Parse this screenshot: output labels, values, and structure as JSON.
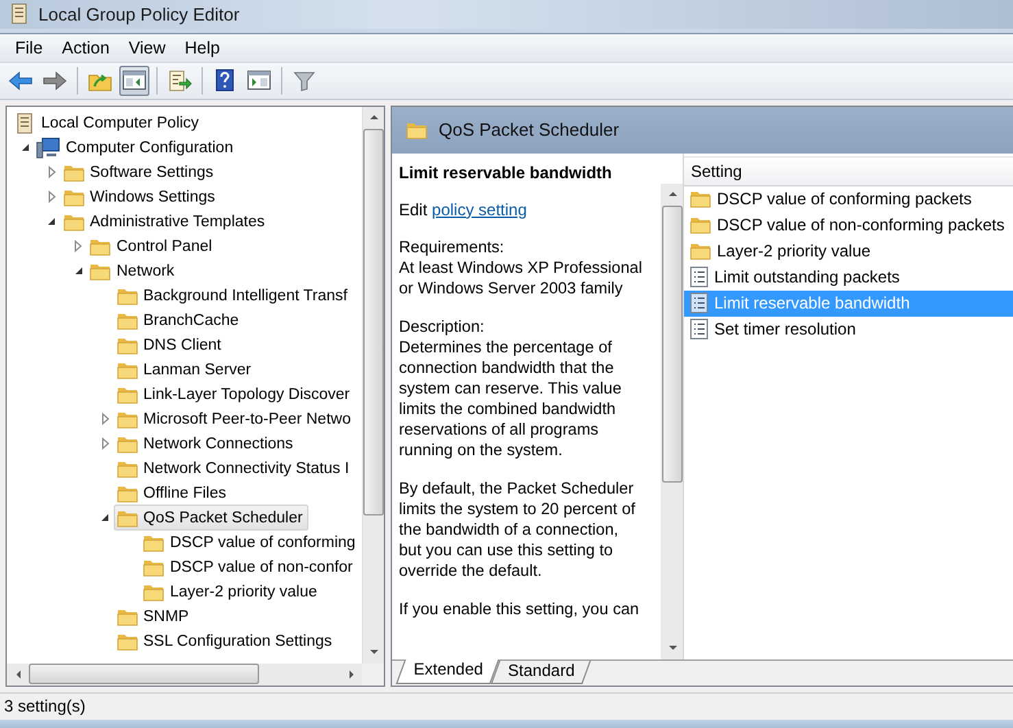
{
  "window": {
    "title": "Local Group Policy Editor"
  },
  "menu": [
    "File",
    "Action",
    "View",
    "Help"
  ],
  "toolbar": [
    {
      "kind": "back",
      "pressed": false
    },
    {
      "kind": "forward",
      "pressed": false
    },
    {
      "kind": "separator"
    },
    {
      "kind": "up",
      "pressed": false
    },
    {
      "kind": "console-tree",
      "pressed": true
    },
    {
      "kind": "separator"
    },
    {
      "kind": "export",
      "pressed": false
    },
    {
      "kind": "separator"
    },
    {
      "kind": "help",
      "pressed": false
    },
    {
      "kind": "action-pane",
      "pressed": false
    },
    {
      "kind": "separator"
    },
    {
      "kind": "filter",
      "pressed": false
    }
  ],
  "tree": [
    {
      "label": "Local Computer Policy",
      "kind": "policy",
      "selected": false,
      "children": [
        {
          "label": "Computer Configuration",
          "kind": "computer",
          "expanded": true,
          "selected": false,
          "children": [
            {
              "label": "Software Settings",
              "kind": "folder",
              "expanded": false,
              "selected": false
            },
            {
              "label": "Windows Settings",
              "kind": "folder",
              "expanded": false,
              "selected": false
            },
            {
              "label": "Administrative Templates",
              "kind": "folder",
              "expanded": true,
              "selected": false,
              "children": [
                {
                  "label": "Control Panel",
                  "kind": "folder",
                  "expanded": false,
                  "selected": false
                },
                {
                  "label": "Network",
                  "kind": "folder",
                  "expanded": true,
                  "selected": false,
                  "children": [
                    {
                      "label": "Background Intelligent Transf",
                      "kind": "folder",
                      "selected": false
                    },
                    {
                      "label": "BranchCache",
                      "kind": "folder",
                      "selected": false
                    },
                    {
                      "label": "DNS Client",
                      "kind": "folder",
                      "selected": false
                    },
                    {
                      "label": "Lanman Server",
                      "kind": "folder",
                      "selected": false
                    },
                    {
                      "label": "Link-Layer Topology Discover",
                      "kind": "folder",
                      "selected": false
                    },
                    {
                      "label": "Microsoft Peer-to-Peer Netwo",
                      "kind": "folder",
                      "expanded": false,
                      "selected": false
                    },
                    {
                      "label": "Network Connections",
                      "kind": "folder",
                      "expanded": false,
                      "selected": false
                    },
                    {
                      "label": "Network Connectivity Status I",
                      "kind": "folder",
                      "selected": false
                    },
                    {
                      "label": "Offline Files",
                      "kind": "folder",
                      "selected": false
                    },
                    {
                      "label": "QoS Packet Scheduler",
                      "kind": "folder",
                      "expanded": true,
                      "selected": true,
                      "children": [
                        {
                          "label": "DSCP value of conforming",
                          "kind": "folder",
                          "selected": false
                        },
                        {
                          "label": "DSCP value of non-confor",
                          "kind": "folder",
                          "selected": false
                        },
                        {
                          "label": "Layer-2 priority value",
                          "kind": "folder",
                          "selected": false
                        }
                      ]
                    },
                    {
                      "label": "SNMP",
                      "kind": "folder",
                      "selected": false
                    },
                    {
                      "label": "SSL Configuration Settings",
                      "kind": "folder",
                      "selected": false
                    }
                  ]
                }
              ]
            }
          ]
        }
      ]
    }
  ],
  "header": {
    "title": "QoS Packet Scheduler"
  },
  "description": {
    "title": "Limit reservable bandwidth",
    "edit_prefix": "Edit",
    "edit_link": "policy setting",
    "paragraphs": [
      [
        "Requirements:",
        "At least Windows XP Professional",
        "or Windows Server 2003 family"
      ],
      [
        "Description:",
        "Determines the percentage of",
        "connection bandwidth that the",
        "system can reserve. This value",
        "limits the combined bandwidth",
        "reservations of all programs",
        "running on the system."
      ],
      [
        "By default, the Packet Scheduler",
        "limits the system to 20 percent of",
        "the bandwidth of a connection,",
        "but you can use this setting to",
        "override the default."
      ],
      [
        "If you enable this setting, you can"
      ]
    ]
  },
  "list": {
    "column": "Setting",
    "rows": [
      {
        "label": "DSCP value of conforming packets",
        "kind": "folder",
        "selected": false
      },
      {
        "label": "DSCP value of non-conforming packets",
        "kind": "folder",
        "selected": false
      },
      {
        "label": "Layer-2 priority value",
        "kind": "folder",
        "selected": false
      },
      {
        "label": "Limit outstanding packets",
        "kind": "setting",
        "selected": false
      },
      {
        "label": "Limit reservable bandwidth",
        "kind": "setting",
        "selected": true
      },
      {
        "label": "Set timer resolution",
        "kind": "setting",
        "selected": false
      }
    ]
  },
  "tabs": [
    {
      "label": "Extended",
      "selected": true
    },
    {
      "label": "Standard",
      "selected": false
    }
  ],
  "status_bar": "3 setting(s)"
}
